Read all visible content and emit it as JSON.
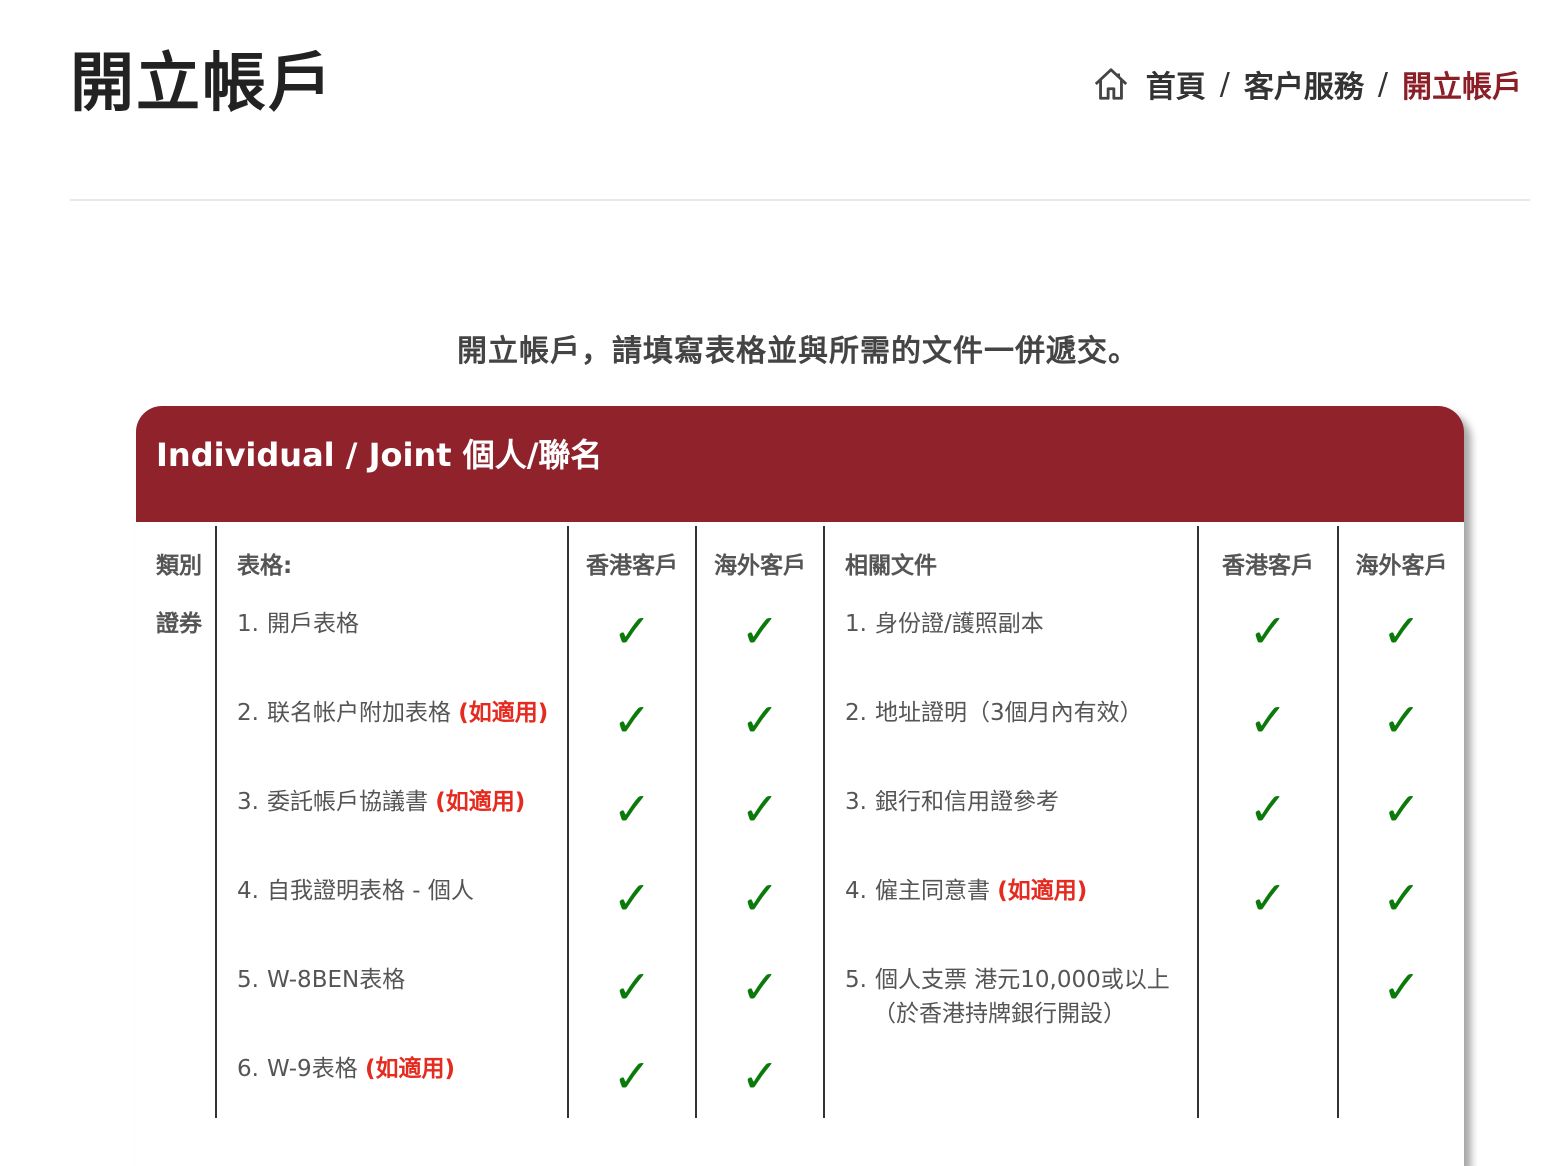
{
  "page": {
    "title": "開立帳戶",
    "intro": "開立帳戶，請填寫表格並與所需的文件一併遞交。"
  },
  "breadcrumb": {
    "home": "首頁",
    "separator": "/",
    "section": "客户服務",
    "current": "開立帳戶"
  },
  "colors": {
    "accent": "#90222c",
    "note": "#e52b1f",
    "check": "#0b7a0b"
  },
  "card": {
    "header": "Individual / Joint 個人/聯名"
  },
  "table": {
    "headers": {
      "category": "類別",
      "forms": "表格:",
      "hk_clients": "香港客戶",
      "overseas_clients": "海外客戶",
      "documents": "相關文件",
      "hk_clients_2": "香港客戶",
      "overseas_clients_2": "海外客戶"
    },
    "category": "證券",
    "check_symbol": "✓",
    "rows": [
      {
        "form_no": "1.",
        "form": "開戶表格",
        "form_note": "",
        "doc_no": "1.",
        "doc": "身份證/護照副本",
        "doc_note": "",
        "doc_sub": ""
      },
      {
        "form_no": "2.",
        "form": "联名帐户附加表格",
        "form_note": "(如適用)",
        "doc_no": "2.",
        "doc": "地址證明（3個月內有效）",
        "doc_note": "",
        "doc_sub": ""
      },
      {
        "form_no": "3.",
        "form": "委託帳戶協議書",
        "form_note": "(如適用)",
        "doc_no": "3.",
        "doc": "銀行和信用證參考",
        "doc_note": "",
        "doc_sub": ""
      },
      {
        "form_no": "4.",
        "form": "自我證明表格 - 個人",
        "form_note": "",
        "doc_no": "4.",
        "doc": "僱主同意書",
        "doc_note": "(如適用)",
        "doc_sub": ""
      },
      {
        "form_no": "5.",
        "form": "W-8BEN表格",
        "form_note": "",
        "doc_no": "5.",
        "doc": "個人支票 港元10,000或以上",
        "doc_note": "",
        "doc_sub": "（於香港持牌銀行開設）"
      },
      {
        "form_no": "6.",
        "form": "W-9表格",
        "form_note": "(如適用)",
        "doc_no": "",
        "doc": "",
        "doc_note": "",
        "doc_sub": ""
      }
    ]
  }
}
